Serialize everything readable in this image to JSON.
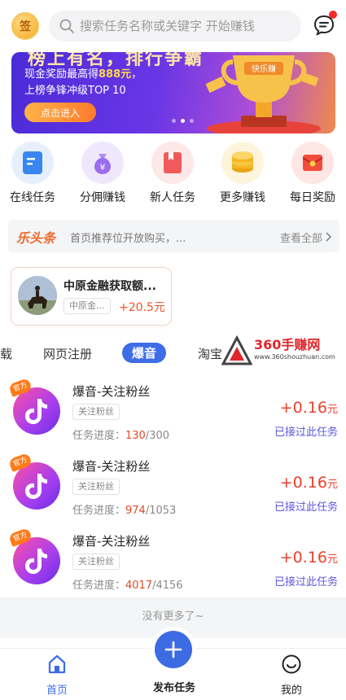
{
  "header": {
    "sign_label": "签",
    "search_placeholder": "搜索任务名称或关键字 开始赚钱"
  },
  "banner": {
    "headline_partial": "榜上有名，排行争霸",
    "line1_prefix": "现金奖励最高得",
    "line1_amount": "888元",
    "line1_suffix": "，",
    "line2": "上榜争锋冲级TOP 10",
    "button_label": "点击进入",
    "trophy_text": "快乐赚",
    "carousel_total": 3,
    "carousel_active": 1
  },
  "menu": [
    {
      "label": "在线任务",
      "icon": "online-task-icon",
      "color": "#3a86f0"
    },
    {
      "label": "分佣赚钱",
      "icon": "money-bag-icon",
      "color": "#9a6cf0"
    },
    {
      "label": "新人任务",
      "icon": "newbie-task-icon",
      "color": "#f05a5a"
    },
    {
      "label": "更多赚钱",
      "icon": "coins-icon",
      "color": "#f5b625"
    },
    {
      "label": "每日奖励",
      "icon": "red-envelope-icon",
      "color": "#f24c3d"
    }
  ],
  "headline": {
    "logo": "乐头条",
    "text": "首页推荐位开放购买，...",
    "view_all": "查看全部"
  },
  "featured": {
    "title": "中原金融获取额...",
    "tag": "中原金...",
    "reward": "+20.5元"
  },
  "tabs": [
    {
      "label": "载"
    },
    {
      "label": "网页注册"
    },
    {
      "label": "爆音",
      "active": true
    },
    {
      "label": "淘宝"
    }
  ],
  "watermark": {
    "title": "360手赚网",
    "url": "www.360shouzhuan.com"
  },
  "tasks": [
    {
      "badge": "官方",
      "title": "爆音-关注粉丝",
      "tag": "关注粉丝",
      "progress_label": "任务进度：",
      "current": "130",
      "total": "/300",
      "reward": "+0.16",
      "unit": "元",
      "status": "已接过此任务"
    },
    {
      "badge": "官方",
      "title": "爆音-关注粉丝",
      "tag": "关注粉丝",
      "progress_label": "任务进度：",
      "current": "974",
      "total": "/1053",
      "reward": "+0.16",
      "unit": "元",
      "status": "已接过此任务"
    },
    {
      "badge": "官方",
      "title": "爆音-关注粉丝",
      "tag": "关注粉丝",
      "progress_label": "任务进度：",
      "current": "4017",
      "total": "/4156",
      "reward": "+0.16",
      "unit": "元",
      "status": "已接过此任务"
    }
  ],
  "list_end": "没有更多了~",
  "bottom_nav": {
    "home": "首页",
    "publish": "发布任务",
    "mine": "我的",
    "active_color": "#3d6be4"
  }
}
